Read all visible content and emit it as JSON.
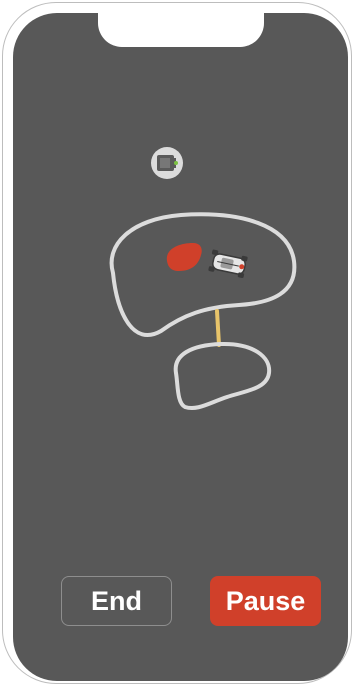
{
  "screen": {
    "background_color": "#585858",
    "frame_color": "#ffffff"
  },
  "map": {
    "device_icon": "robot-mower-station-icon",
    "robot_icon": "robot-mower-icon",
    "zone_outline_color": "#dcdcdc",
    "connector_color": "#e8c46a",
    "progress_area_color": "#d0402a"
  },
  "controls": {
    "end_label": "End",
    "pause_label": "Pause",
    "pause_color": "#d0402a"
  }
}
